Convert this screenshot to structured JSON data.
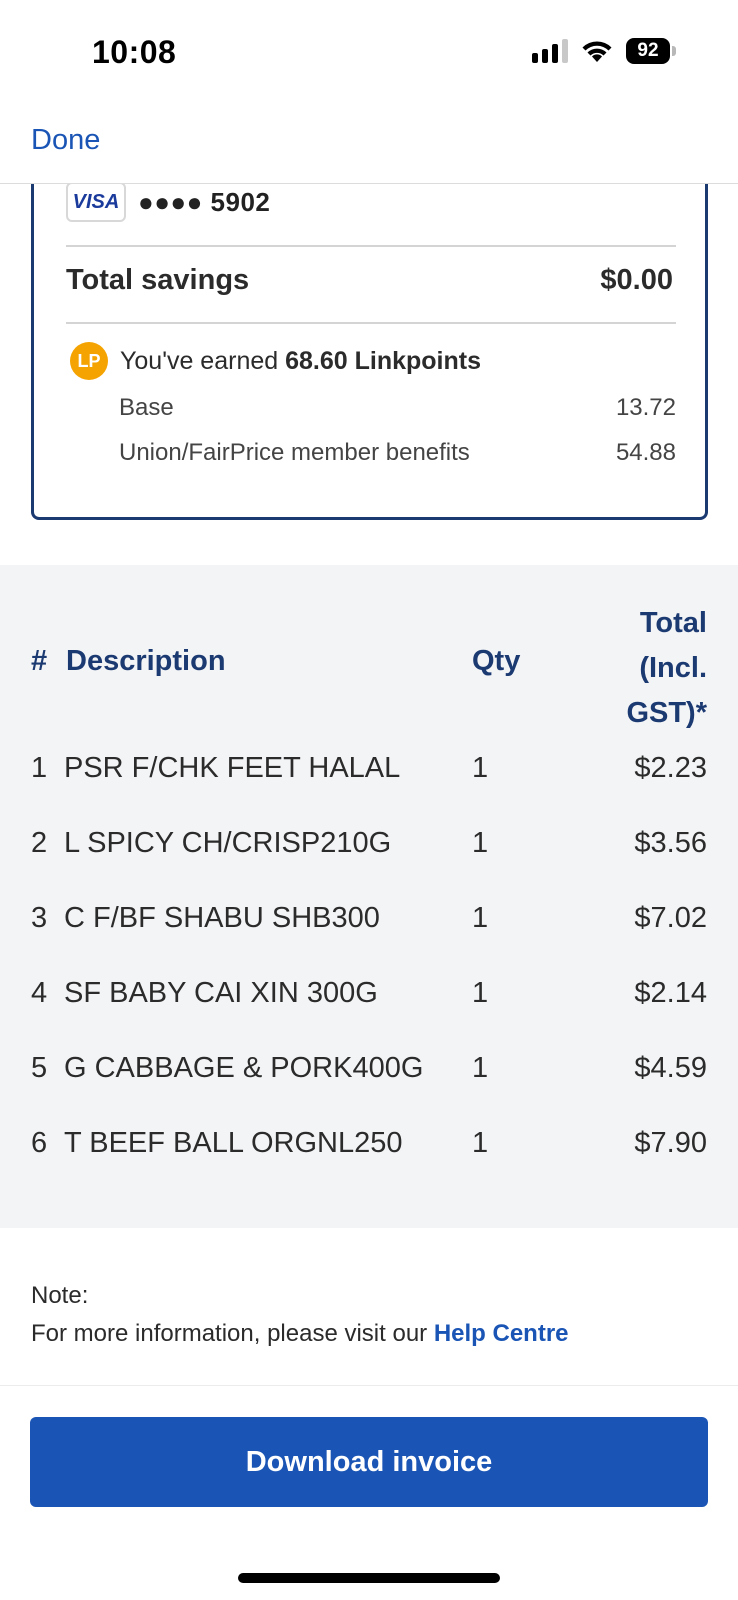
{
  "status_bar": {
    "time": "10:08",
    "battery": "92"
  },
  "header": {
    "done_label": "Done"
  },
  "payment": {
    "card_brand": "VISA",
    "card_masked": "●●●● 5902",
    "savings_label": "Total savings",
    "savings_value": "$0.00",
    "lp_icon_text": "LP",
    "linkpoints_prefix": "You've earned ",
    "linkpoints_value": "68.60 Linkpoints",
    "base_label": "Base",
    "base_value": "13.72",
    "union_label": "Union/FairPrice member benefits",
    "union_value": "54.88"
  },
  "table": {
    "headers": {
      "index": "#",
      "description": "Description",
      "qty": "Qty",
      "total_line1": "Total",
      "total_line2": "(Incl.",
      "total_line3": "GST)*"
    },
    "items": [
      {
        "index": "1",
        "description": "PSR F/CHK FEET HALAL",
        "qty": "1",
        "total": "$2.23"
      },
      {
        "index": "2",
        "description": "L SPICY CH/CRISP210G",
        "qty": "1",
        "total": "$3.56"
      },
      {
        "index": "3",
        "description": "C F/BF SHABU SHB300",
        "qty": "1",
        "total": "$7.02"
      },
      {
        "index": "4",
        "description": "SF BABY CAI XIN 300G",
        "qty": "1",
        "total": "$2.14"
      },
      {
        "index": "5",
        "description": "G CABBAGE & PORK400G",
        "qty": "1",
        "total": "$4.59"
      },
      {
        "index": "6",
        "description": "T BEEF BALL ORGNL250",
        "qty": "1",
        "total": "$7.90"
      }
    ]
  },
  "note": {
    "title": "Note:",
    "text": "For more information, please visit our ",
    "link_label": "Help Centre"
  },
  "actions": {
    "download_label": "Download invoice"
  },
  "colors": {
    "accent": "#1a55b5",
    "navy": "#1c3a72",
    "linkpoints": "#f5a300",
    "table_bg": "#f3f4f6"
  },
  "icons": [
    "signal-icon",
    "wifi-icon",
    "battery-icon",
    "visa-logo-icon",
    "linkpoints-icon"
  ]
}
